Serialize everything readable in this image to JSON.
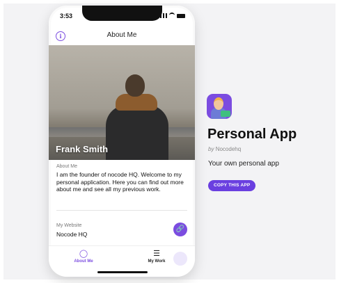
{
  "status_bar": {
    "time": "3:53"
  },
  "header": {
    "title": "About Me"
  },
  "hero": {
    "name": "Frank Smith"
  },
  "about": {
    "label": "About Me",
    "text": "I am the founder of nocode HQ. Welcome to my personal application. Here you can find out more about me and see all my previous work."
  },
  "website": {
    "label": "My Website",
    "value": "Nocode HQ"
  },
  "tabs": [
    {
      "label": "About Me",
      "icon": "award-icon"
    },
    {
      "label": "My Work",
      "icon": "list-icon"
    }
  ],
  "app_info": {
    "title": "Personal App",
    "by_prefix": "by",
    "author": "Nocodehq",
    "description": "Your own personal app",
    "copy_button": "COPY THIS APP"
  },
  "colors": {
    "accent": "#7b4ce0",
    "button": "#6a3fe0",
    "background": "#f3f3f5"
  }
}
